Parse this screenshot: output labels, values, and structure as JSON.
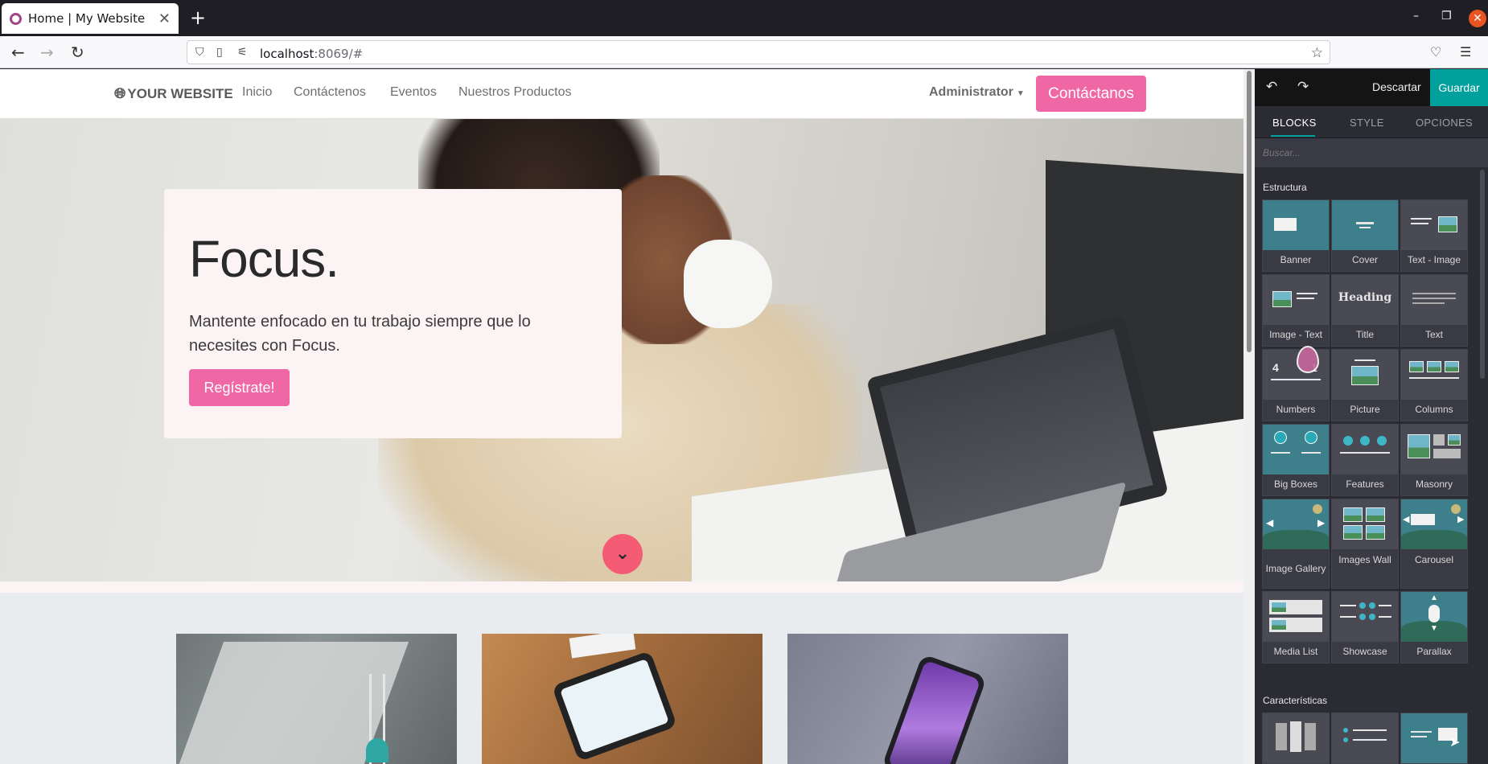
{
  "browser": {
    "tab_title": "Home | My Website",
    "url_host": "localhost",
    "url_rest": ":8069/#"
  },
  "site": {
    "logo": "YOUR WEBSITE",
    "menu": [
      "Inicio",
      "Contáctenos",
      "Eventos",
      "Nuestros Productos"
    ],
    "admin": "Administrator",
    "contact_button": "Contáctanos",
    "hero": {
      "title": "Focus.",
      "text": "Mantente enfocado en tu trabajo siempre que lo necesites con Focus.",
      "button": "Regístrate!"
    }
  },
  "editor": {
    "discard": "Descartar",
    "save": "Guardar",
    "tabs": [
      "BLOCKS",
      "STYLE",
      "OPCIONES"
    ],
    "search_placeholder": "Buscar...",
    "section_structure": "Estructura",
    "section_features": "Características",
    "blocks": [
      "Banner",
      "Cover",
      "Text - Image",
      "Image - Text",
      "Title",
      "Text",
      "Numbers",
      "Picture",
      "Columns",
      "Big Boxes",
      "Features",
      "Masonry",
      "Image Gallery",
      "Images Wall",
      "Carousel",
      "Media List",
      "Showcase",
      "Parallax"
    ],
    "title_thumb_text": "Heading",
    "numbers_thumb": [
      "4",
      "1"
    ]
  },
  "colors": {
    "accent_pink": "#f067a6",
    "editor_teal": "#00a09d",
    "editor_bg": "#2b2b33"
  }
}
